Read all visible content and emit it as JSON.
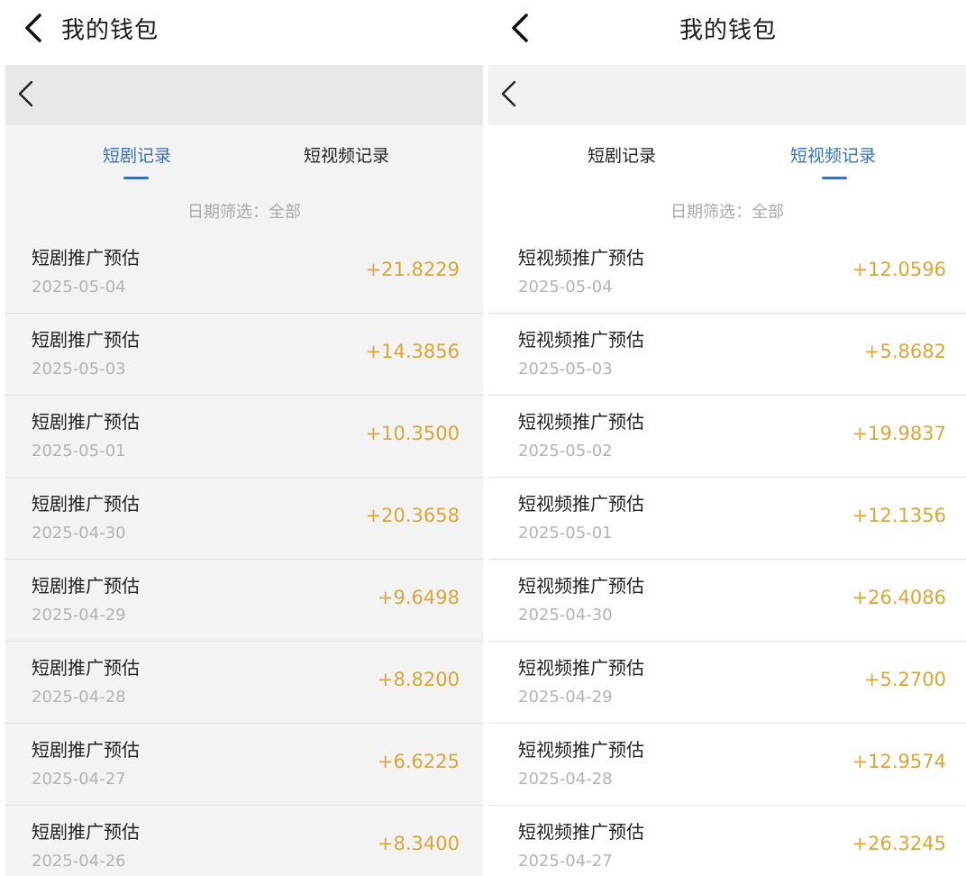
{
  "left": {
    "header_title": "我的钱包",
    "tabs": [
      {
        "label": "短剧记录",
        "active": true
      },
      {
        "label": "短视频记录",
        "active": false
      }
    ],
    "filter": "日期筛选：全部",
    "rows": [
      {
        "title": "短剧推广预估",
        "date": "2025-05-04",
        "amount": "+21.8229"
      },
      {
        "title": "短剧推广预估",
        "date": "2025-05-03",
        "amount": "+14.3856"
      },
      {
        "title": "短剧推广预估",
        "date": "2025-05-01",
        "amount": "+10.3500"
      },
      {
        "title": "短剧推广预估",
        "date": "2025-04-30",
        "amount": "+20.3658"
      },
      {
        "title": "短剧推广预估",
        "date": "2025-04-29",
        "amount": "+9.6498"
      },
      {
        "title": "短剧推广预估",
        "date": "2025-04-28",
        "amount": "+8.8200"
      },
      {
        "title": "短剧推广预估",
        "date": "2025-04-27",
        "amount": "+6.6225"
      },
      {
        "title": "短剧推广预估",
        "date": "2025-04-26",
        "amount": "+8.3400"
      }
    ]
  },
  "right": {
    "header_title": "我的钱包",
    "tabs": [
      {
        "label": "短剧记录",
        "active": false
      },
      {
        "label": "短视频记录",
        "active": true
      }
    ],
    "filter": "日期筛选：全部",
    "rows": [
      {
        "title": "短视频推广预估",
        "date": "2025-05-04",
        "amount": "+12.0596"
      },
      {
        "title": "短视频推广预估",
        "date": "2025-05-03",
        "amount": "+5.8682"
      },
      {
        "title": "短视频推广预估",
        "date": "2025-05-02",
        "amount": "+19.9837"
      },
      {
        "title": "短视频推广预估",
        "date": "2025-05-01",
        "amount": "+12.1356"
      },
      {
        "title": "短视频推广预估",
        "date": "2025-04-30",
        "amount": "+26.4086"
      },
      {
        "title": "短视频推广预估",
        "date": "2025-04-29",
        "amount": "+5.2700"
      },
      {
        "title": "短视频推广预估",
        "date": "2025-04-28",
        "amount": "+12.9574"
      },
      {
        "title": "短视频推广预估",
        "date": "2025-04-27",
        "amount": "+26.3245"
      }
    ]
  },
  "colors": {
    "accent": "#3a6fb0",
    "amount": "#d8a63a",
    "date": "#b3b3b3"
  }
}
